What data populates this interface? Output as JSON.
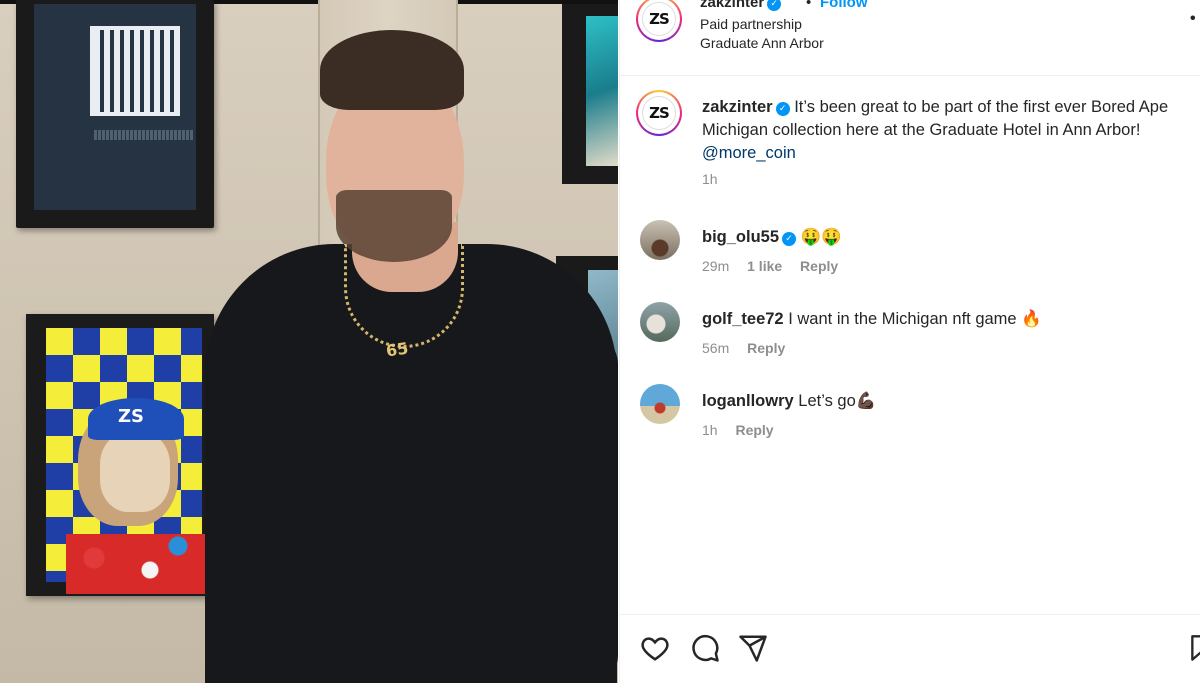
{
  "post": {
    "author": "zakzinter",
    "avatar_text": "ZS",
    "follow_label": "Follow",
    "separator": "•",
    "subtitle": "Paid partnership",
    "location": "Graduate Ann Arbor",
    "more_label": "•"
  },
  "caption": {
    "author": "zakzinter",
    "text": " It’s been great to be part of the first ever Bored Ape Michigan collection here at the Graduate Hotel in Ann Arbor! ",
    "mention": "@more_coin",
    "time": "1h"
  },
  "comments": [
    {
      "author": "big_olu55",
      "verified": true,
      "text": "🤑🤑",
      "time": "29m",
      "likes": "1 like",
      "reply": "Reply"
    },
    {
      "author": "golf_tee72",
      "verified": false,
      "text": "I want in the Michigan nft game 🔥",
      "time": "56m",
      "likes": "",
      "reply": "Reply"
    },
    {
      "author": "loganllowry",
      "verified": false,
      "text": "Let’s go💪🏿",
      "time": "1h",
      "likes": "",
      "reply": "Reply"
    }
  ],
  "photo": {
    "pendant_text": "65",
    "cap_text": "ZS"
  },
  "actions": {
    "icons": [
      "heart-icon",
      "comment-icon",
      "share-icon",
      "bookmark-icon"
    ]
  },
  "colors": {
    "link_blue": "#0095f6",
    "mention_blue": "#00376b",
    "muted": "#8e8e8e",
    "text": "#262626"
  }
}
